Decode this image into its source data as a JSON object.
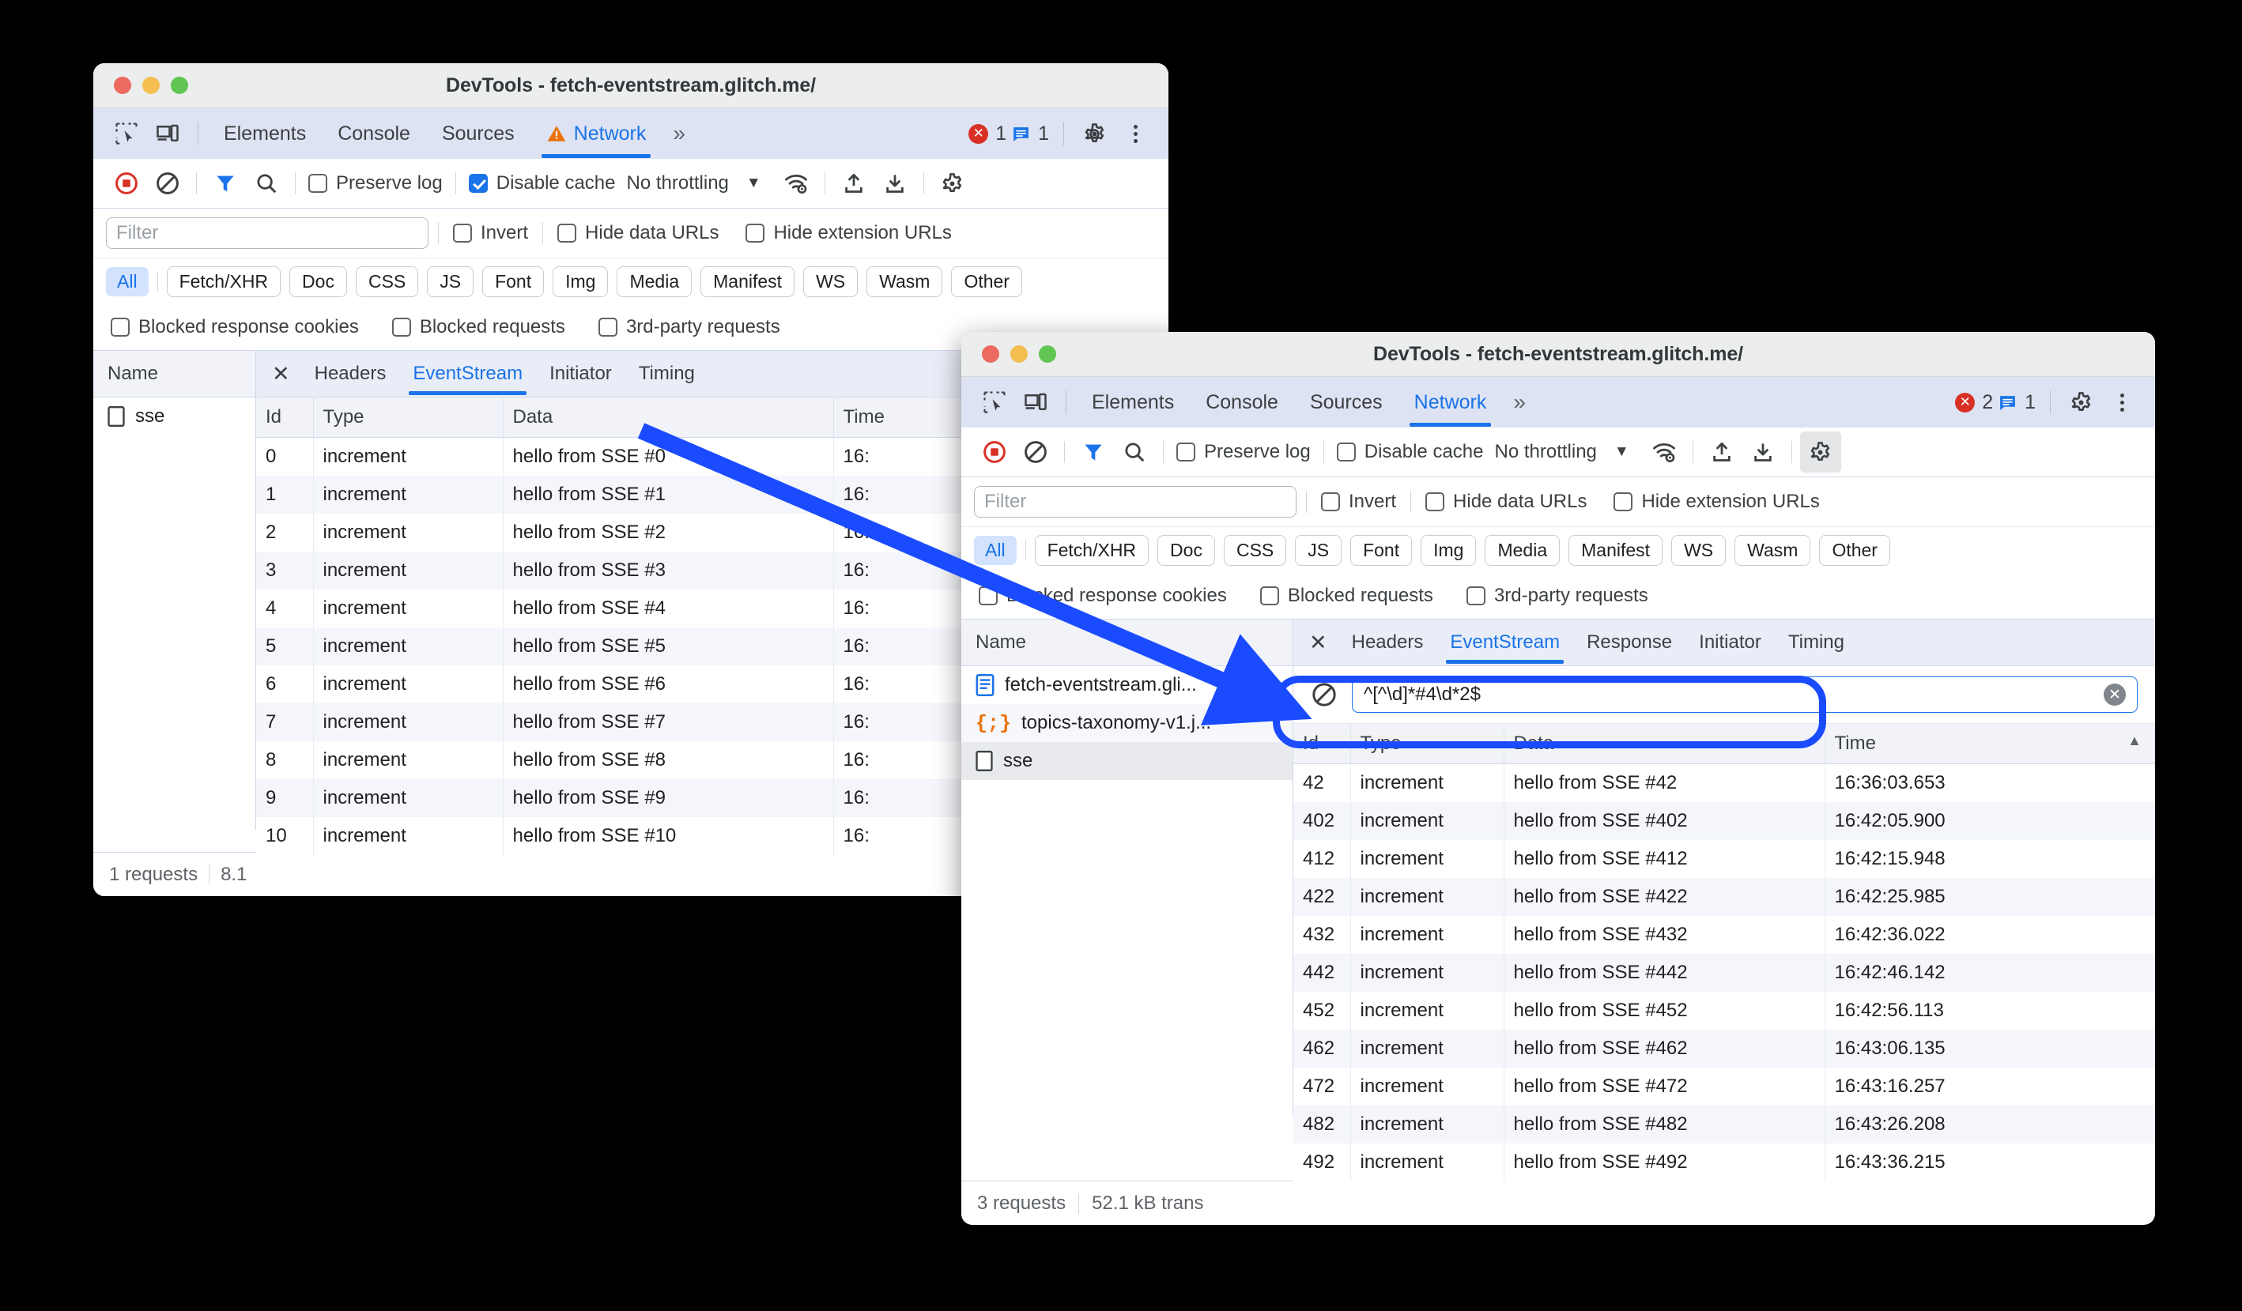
{
  "window1": {
    "title": "DevTools - fetch-eventstream.glitch.me/",
    "traffic_lights": [
      "close",
      "minimize",
      "zoom"
    ],
    "toolbar_icons": [
      "inspect-icon",
      "device-toolbar-icon"
    ],
    "panel_tabs": [
      {
        "label": "Elements",
        "active": false,
        "warning": false
      },
      {
        "label": "Console",
        "active": false,
        "warning": false
      },
      {
        "label": "Sources",
        "active": false,
        "warning": false
      },
      {
        "label": "Network",
        "active": true,
        "warning": true
      }
    ],
    "more_tabs_label": "»",
    "error_count": "1",
    "message_count": "1",
    "network_toolbar": {
      "record_icon": "record-stop-icon",
      "clear_icon": "clear-icon",
      "filter_icon": "filter-funnel-icon",
      "search_icon": "search-icon",
      "preserve_log": {
        "label": "Preserve log",
        "checked": false
      },
      "disable_cache": {
        "label": "Disable cache",
        "checked": true
      },
      "throttling": "No throttling",
      "wifi_icon": "network-conditions-icon",
      "import_icon": "upload-har-icon",
      "export_icon": "download-har-icon",
      "settings_icon": "gear-icon",
      "settings_active": false
    },
    "filter_row": {
      "placeholder": "Filter",
      "value": "",
      "invert": {
        "label": "Invert",
        "checked": false
      },
      "hide_data_urls": {
        "label": "Hide data URLs",
        "checked": false
      },
      "hide_extension_urls": {
        "label": "Hide extension URLs",
        "checked": false
      }
    },
    "type_chips": [
      "All",
      "Fetch/XHR",
      "Doc",
      "CSS",
      "JS",
      "Font",
      "Img",
      "Media",
      "Manifest",
      "WS",
      "Wasm",
      "Other"
    ],
    "type_chip_selected": "All",
    "more_filters": [
      {
        "label": "Blocked response cookies",
        "checked": false
      },
      {
        "label": "Blocked requests",
        "checked": false
      },
      {
        "label": "3rd-party requests",
        "checked": false
      }
    ],
    "name_column_header": "Name",
    "requests": [
      {
        "name": "sse",
        "icon": "generic-document-icon",
        "selected": false
      }
    ],
    "detail_tabs": [
      {
        "label": "Headers",
        "active": false
      },
      {
        "label": "EventStream",
        "active": true
      },
      {
        "label": "Initiator",
        "active": false
      },
      {
        "label": "Timing",
        "active": false
      }
    ],
    "close_label": "✕",
    "event_columns": [
      "Id",
      "Type",
      "Data",
      "Time"
    ],
    "events": [
      {
        "id": "0",
        "type": "increment",
        "data": "hello from SSE #0",
        "time": "16:"
      },
      {
        "id": "1",
        "type": "increment",
        "data": "hello from SSE #1",
        "time": "16:"
      },
      {
        "id": "2",
        "type": "increment",
        "data": "hello from SSE #2",
        "time": "16:"
      },
      {
        "id": "3",
        "type": "increment",
        "data": "hello from SSE #3",
        "time": "16:"
      },
      {
        "id": "4",
        "type": "increment",
        "data": "hello from SSE #4",
        "time": "16:"
      },
      {
        "id": "5",
        "type": "increment",
        "data": "hello from SSE #5",
        "time": "16:"
      },
      {
        "id": "6",
        "type": "increment",
        "data": "hello from SSE #6",
        "time": "16:"
      },
      {
        "id": "7",
        "type": "increment",
        "data": "hello from SSE #7",
        "time": "16:"
      },
      {
        "id": "8",
        "type": "increment",
        "data": "hello from SSE #8",
        "time": "16:"
      },
      {
        "id": "9",
        "type": "increment",
        "data": "hello from SSE #9",
        "time": "16:"
      },
      {
        "id": "10",
        "type": "increment",
        "data": "hello from SSE #10",
        "time": "16:"
      }
    ],
    "status": {
      "requests": "1 requests",
      "transferred": "8.1"
    }
  },
  "window2": {
    "title": "DevTools - fetch-eventstream.glitch.me/",
    "panel_tabs": [
      {
        "label": "Elements",
        "active": false,
        "warning": false
      },
      {
        "label": "Console",
        "active": false,
        "warning": false
      },
      {
        "label": "Sources",
        "active": false,
        "warning": false
      },
      {
        "label": "Network",
        "active": true,
        "warning": false
      }
    ],
    "more_tabs_label": "»",
    "error_count": "2",
    "message_count": "1",
    "network_toolbar": {
      "preserve_log": {
        "label": "Preserve log",
        "checked": false
      },
      "disable_cache": {
        "label": "Disable cache",
        "checked": false
      },
      "throttling": "No throttling",
      "settings_icon": "gear-icon",
      "settings_active": true
    },
    "filter_row": {
      "placeholder": "Filter",
      "value": "",
      "invert": {
        "label": "Invert",
        "checked": false
      },
      "hide_data_urls": {
        "label": "Hide data URLs",
        "checked": false
      },
      "hide_extension_urls": {
        "label": "Hide extension URLs",
        "checked": false
      }
    },
    "type_chips": [
      "All",
      "Fetch/XHR",
      "Doc",
      "CSS",
      "JS",
      "Font",
      "Img",
      "Media",
      "Manifest",
      "WS",
      "Wasm",
      "Other"
    ],
    "type_chip_selected": "All",
    "more_filters": [
      {
        "label": "Blocked response cookies",
        "checked": false
      },
      {
        "label": "Blocked requests",
        "checked": false
      },
      {
        "label": "3rd-party requests",
        "checked": false
      }
    ],
    "name_column_header": "Name",
    "requests": [
      {
        "name": "fetch-eventstream.gli...",
        "icon": "document-icon",
        "selected": false
      },
      {
        "name": "topics-taxonomy-v1.j...",
        "icon": "json-icon",
        "selected": false
      },
      {
        "name": "sse",
        "icon": "generic-document-icon",
        "selected": true
      }
    ],
    "detail_tabs": [
      {
        "label": "Headers",
        "active": false
      },
      {
        "label": "EventStream",
        "active": true
      },
      {
        "label": "Response",
        "active": false
      },
      {
        "label": "Initiator",
        "active": false
      },
      {
        "label": "Timing",
        "active": false
      }
    ],
    "close_label": "✕",
    "eventstream_filter": {
      "block_icon": "no-entry-filter-icon",
      "value": "^[^\\d]*#4\\d*2$",
      "clear_icon": "clear-input-icon"
    },
    "event_columns": [
      "Id",
      "Type",
      "Data",
      "Time"
    ],
    "sort_column": "Time",
    "sort_direction": "ascending",
    "events": [
      {
        "id": "42",
        "type": "increment",
        "data": "hello from SSE #42",
        "time": "16:36:03.653"
      },
      {
        "id": "402",
        "type": "increment",
        "data": "hello from SSE #402",
        "time": "16:42:05.900"
      },
      {
        "id": "412",
        "type": "increment",
        "data": "hello from SSE #412",
        "time": "16:42:15.948"
      },
      {
        "id": "422",
        "type": "increment",
        "data": "hello from SSE #422",
        "time": "16:42:25.985"
      },
      {
        "id": "432",
        "type": "increment",
        "data": "hello from SSE #432",
        "time": "16:42:36.022"
      },
      {
        "id": "442",
        "type": "increment",
        "data": "hello from SSE #442",
        "time": "16:42:46.142"
      },
      {
        "id": "452",
        "type": "increment",
        "data": "hello from SSE #452",
        "time": "16:42:56.113"
      },
      {
        "id": "462",
        "type": "increment",
        "data": "hello from SSE #462",
        "time": "16:43:06.135"
      },
      {
        "id": "472",
        "type": "increment",
        "data": "hello from SSE #472",
        "time": "16:43:16.257"
      },
      {
        "id": "482",
        "type": "increment",
        "data": "hello from SSE #482",
        "time": "16:43:26.208"
      },
      {
        "id": "492",
        "type": "increment",
        "data": "hello from SSE #492",
        "time": "16:43:36.215"
      }
    ],
    "status": {
      "requests": "3 requests",
      "transferred": "52.1 kB trans"
    }
  },
  "annotation": {
    "arrow_color": "#1a4bff",
    "highlight_color": "#1a4bff"
  }
}
